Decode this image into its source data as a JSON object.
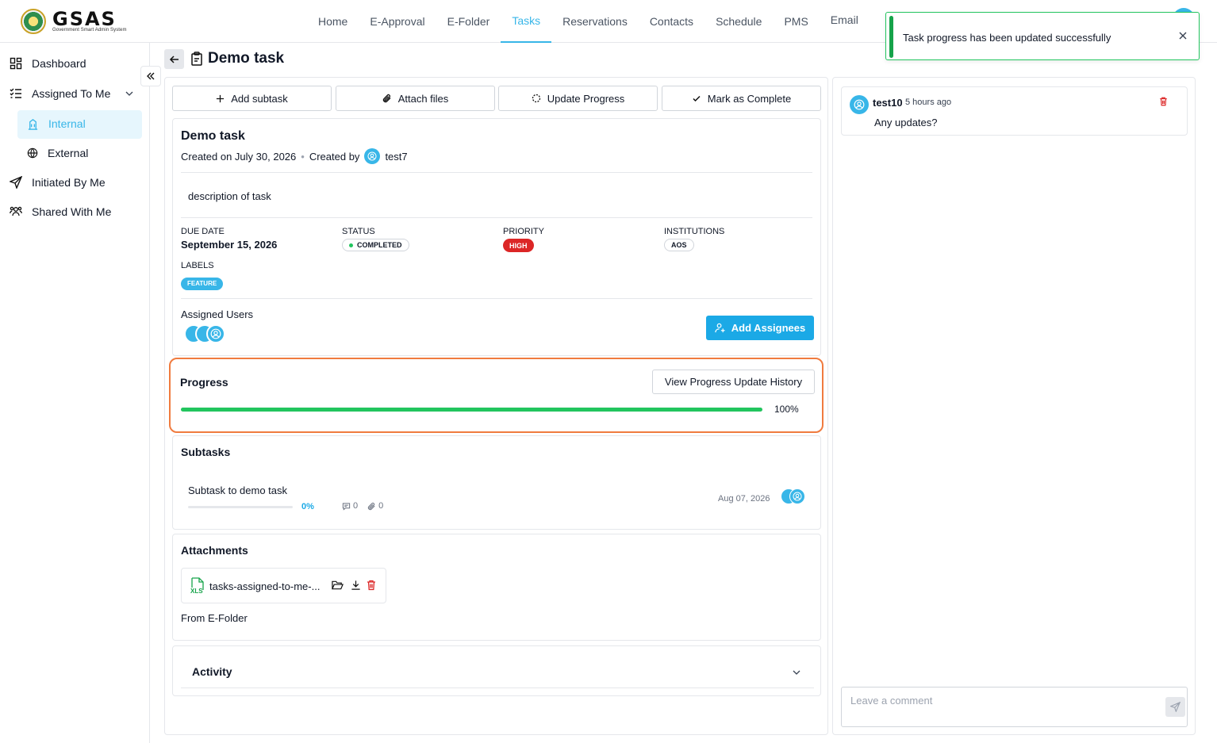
{
  "header": {
    "logo_text": "GSAS",
    "logo_subtitle": "Government Smart Admin System",
    "nav": [
      {
        "label": "Home"
      },
      {
        "label": "E-Approval"
      },
      {
        "label": "E-Folder"
      },
      {
        "label": "Tasks",
        "active": true
      },
      {
        "label": "Reservations"
      },
      {
        "label": "Contacts"
      },
      {
        "label": "Schedule"
      },
      {
        "label": "PMS"
      },
      {
        "label": "Email"
      }
    ]
  },
  "toast": {
    "message": "Task progress has been updated successfully"
  },
  "sidebar": {
    "items": [
      {
        "label": "Dashboard",
        "icon": "dashboard-icon"
      },
      {
        "label": "Assigned To Me",
        "icon": "list-check-icon",
        "expanded": true
      },
      {
        "label": "Internal",
        "icon": "building-icon",
        "active": true
      },
      {
        "label": "External",
        "icon": "globe-icon"
      },
      {
        "label": "Initiated By Me",
        "icon": "send-icon"
      },
      {
        "label": "Shared With Me",
        "icon": "users-icon"
      }
    ]
  },
  "page": {
    "title": "Demo task"
  },
  "actions": {
    "add_subtask": "Add subtask",
    "attach_files": "Attach files",
    "update_progress": "Update Progress",
    "mark_complete": "Mark as Complete"
  },
  "task": {
    "title": "Demo task",
    "created_on": "Created on July 30, 2026",
    "created_by_label": "Created by",
    "created_by": "test7",
    "description": "description of task",
    "due_date_label": "DUE DATE",
    "due_date": "September 15, 2026",
    "status_label": "STATUS",
    "status": "COMPLETED",
    "priority_label": "PRIORITY",
    "priority": "HIGH",
    "institutions_label": "INSTITUTIONS",
    "institution": "AOS",
    "labels_label": "LABELS",
    "label": "FEATURE",
    "assigned_users_label": "Assigned Users",
    "add_assignees": "Add Assignees"
  },
  "progress": {
    "title": "Progress",
    "history_button": "View Progress Update History",
    "percent_text": "100%",
    "value": 1.0
  },
  "subtasks": {
    "title": "Subtasks",
    "items": [
      {
        "name": "Subtask to demo task",
        "percent": "0%",
        "comments": "0",
        "attachments": "0",
        "date": "Aug 07, 2026"
      }
    ]
  },
  "attachments": {
    "title": "Attachments",
    "file_name": "tasks-assigned-to-me-...",
    "file_type": "XLS",
    "from_label": "From E-Folder"
  },
  "activity": {
    "title": "Activity"
  },
  "comments": {
    "items": [
      {
        "author": "test10",
        "time": "5 hours ago",
        "text": "Any updates?"
      }
    ],
    "placeholder": "Leave a comment"
  },
  "colors": {
    "accent": "#38b6e8",
    "success": "#22c55e",
    "danger": "#dc2626",
    "highlight": "#f07b3f"
  }
}
